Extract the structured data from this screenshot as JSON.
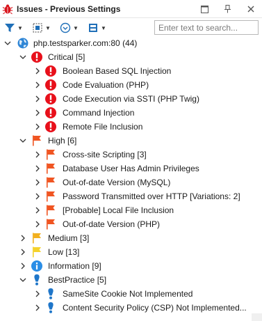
{
  "window": {
    "title": "Issues - Previous Settings",
    "colors": {
      "critical": "#e8101b",
      "high": "#f05522",
      "medium": "#f2b01e",
      "low": "#f5d22b",
      "info": "#2b8ee6",
      "bestpractice": "#1f76c9"
    }
  },
  "toolbar": {
    "filter_icon": "filter-icon",
    "group_icon": "group-icon",
    "view_icon": "view-options-icon",
    "layout_icon": "layout-icon",
    "search_placeholder": "Enter text to search..."
  },
  "tree": {
    "root": {
      "label": "php.testsparker.com:80 (44)",
      "icon": "globe-icon"
    },
    "critical": {
      "label": "Critical [5]",
      "items": [
        "Boolean Based SQL Injection",
        "Code Evaluation (PHP)",
        "Code Execution via SSTI (PHP Twig)",
        "Command Injection",
        "Remote File Inclusion"
      ]
    },
    "high": {
      "label": "High [6]",
      "items": [
        "Cross-site Scripting [3]",
        "Database User Has Admin Privileges",
        "Out-of-date Version (MySQL)",
        "Password Transmitted over HTTP [Variations: 2]",
        "[Probable] Local File Inclusion",
        "Out-of-date Version (PHP)"
      ]
    },
    "medium": {
      "label": "Medium [3]"
    },
    "low": {
      "label": "Low [13]"
    },
    "information": {
      "label": "Information [9]"
    },
    "bestpractice": {
      "label": "BestPractice [5]",
      "items": [
        "SameSite Cookie Not Implemented",
        "Content Security Policy (CSP) Not Implemented..."
      ]
    }
  }
}
